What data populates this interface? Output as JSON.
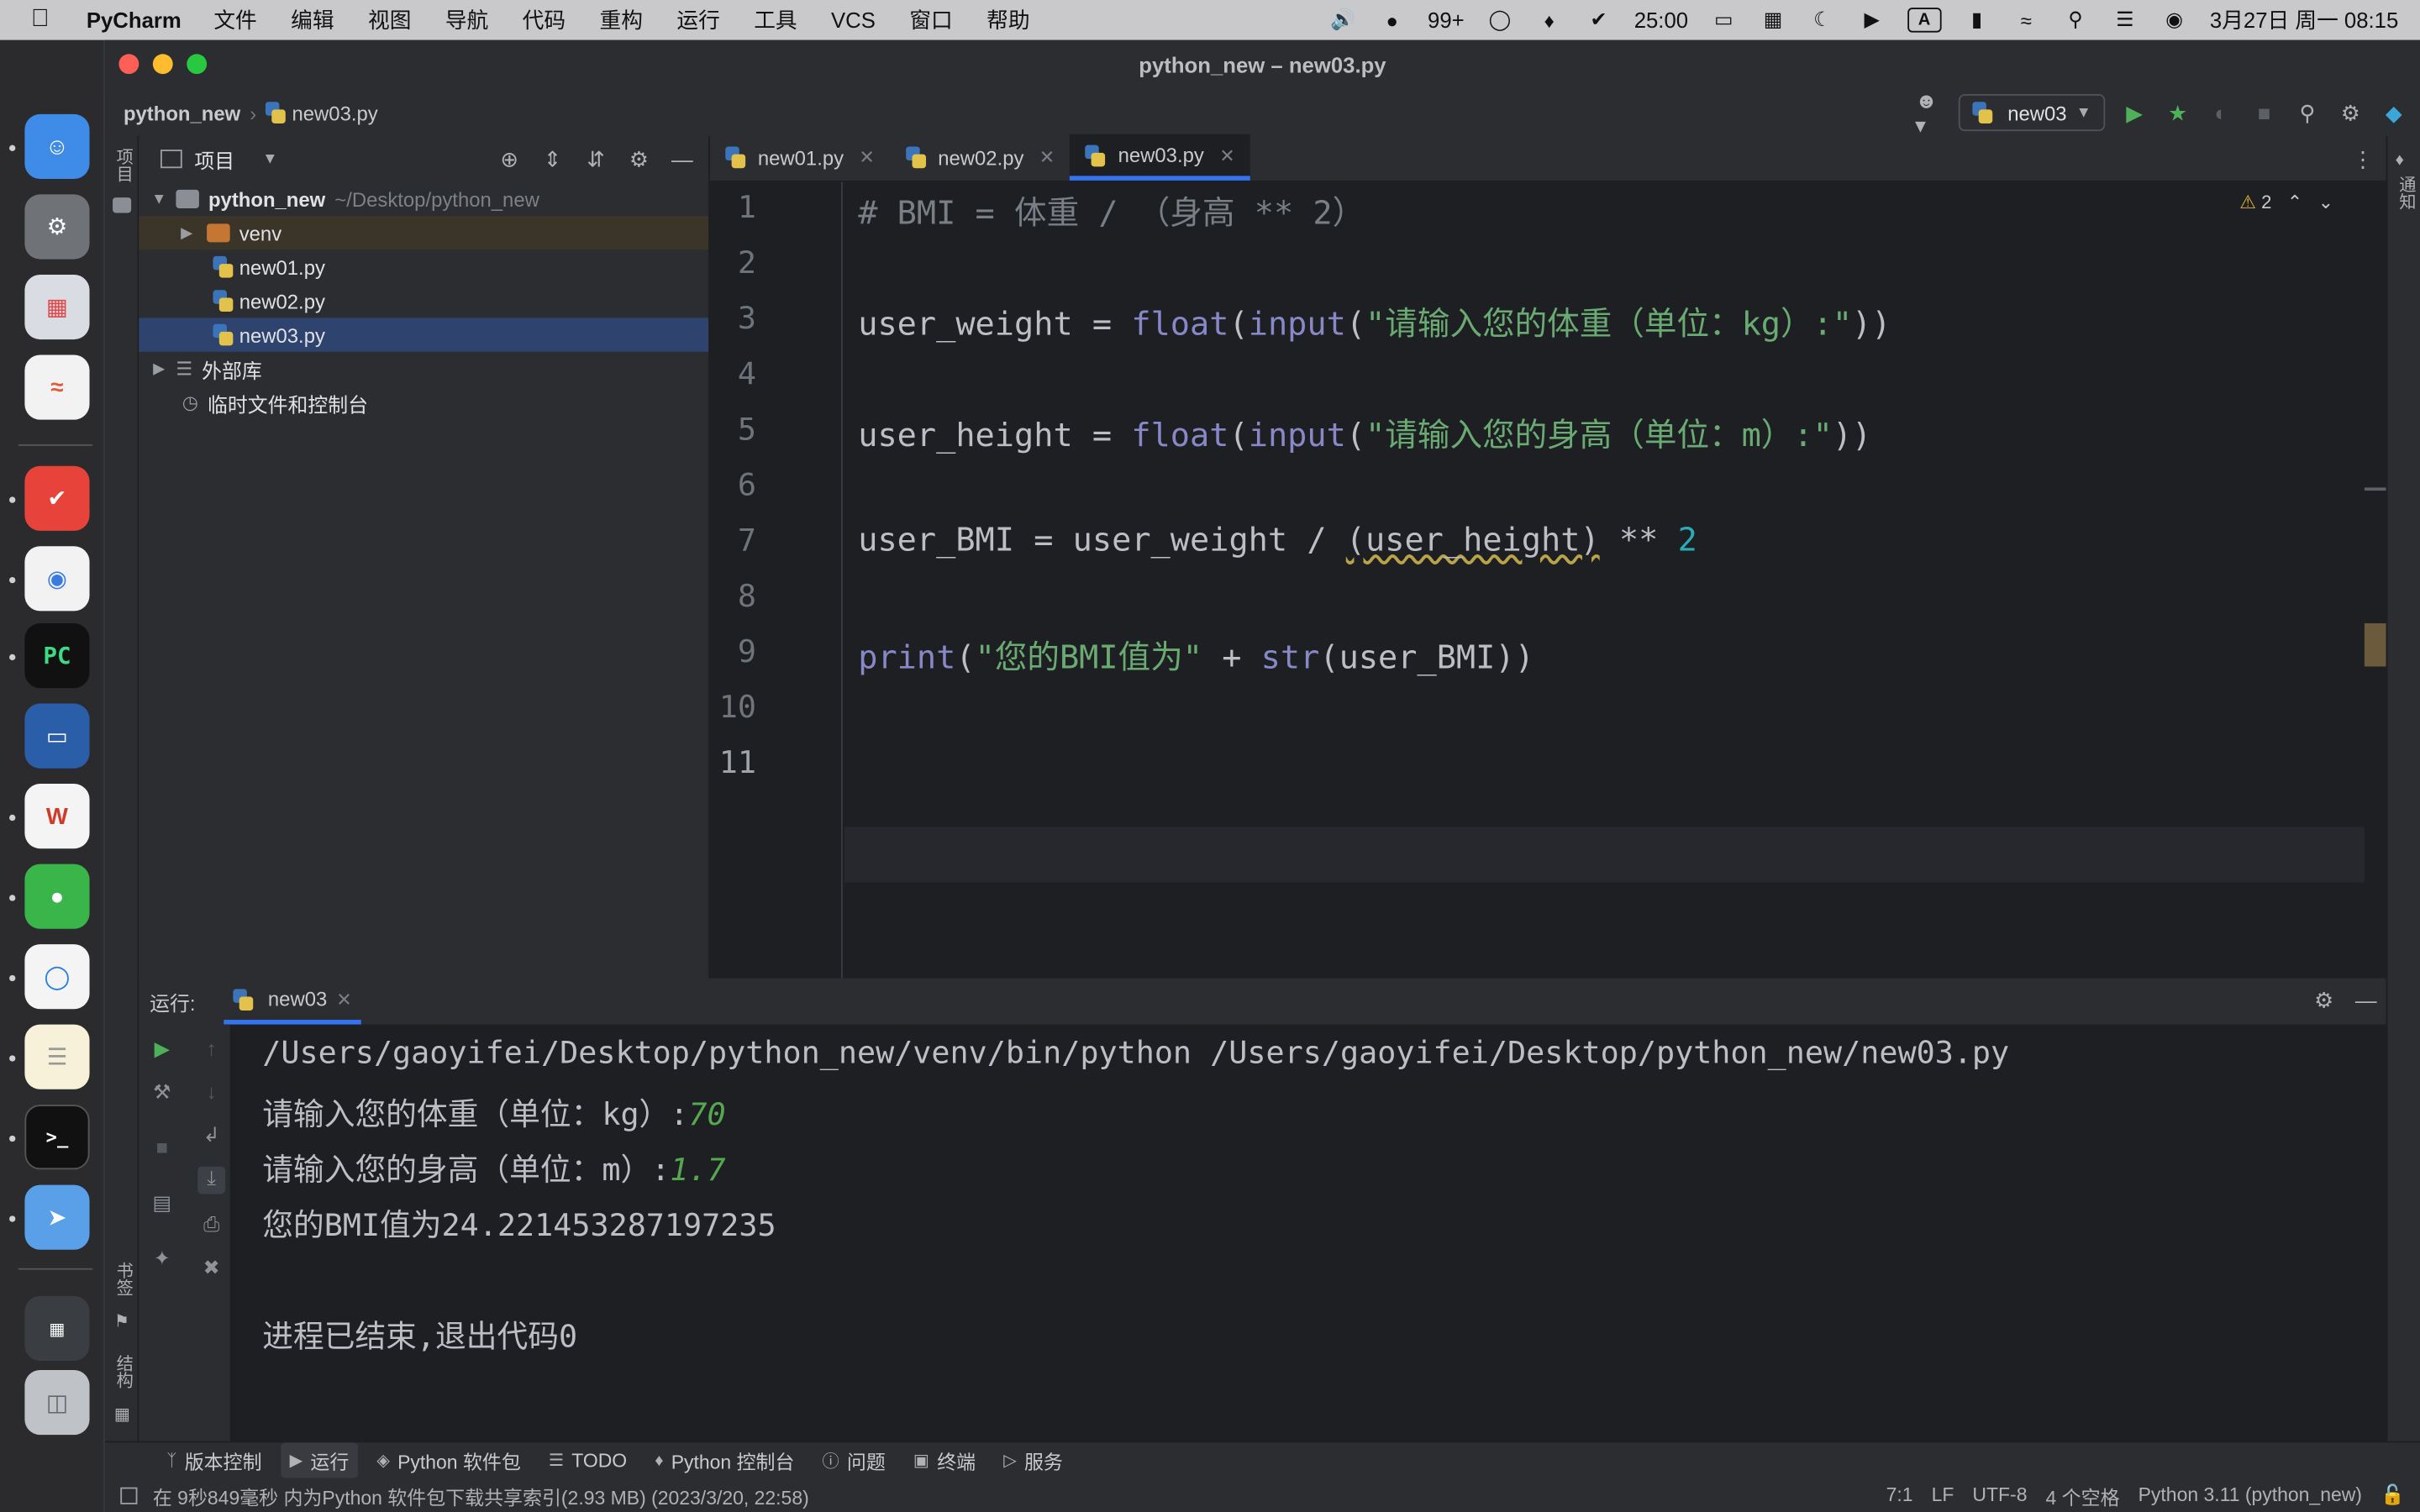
{
  "menubar": {
    "app_name": "PyCharm",
    "items": [
      "文件",
      "编辑",
      "视图",
      "导航",
      "代码",
      "重构",
      "运行",
      "工具",
      "VCS",
      "窗口",
      "帮助"
    ],
    "wechat_badge": "99+",
    "timer": "25:00",
    "input_method": "A",
    "clock": "3月27日 周一  08:15"
  },
  "window": {
    "title": "python_new – new03.py",
    "breadcrumb": {
      "project": "python_new",
      "file": "new03.py"
    },
    "run_config": "new03"
  },
  "sidebar_labels": {
    "project": "项目",
    "bookmarks": "书签",
    "structure": "结构",
    "notifications": "通知"
  },
  "project_panel": {
    "header": "项目",
    "root": {
      "name": "python_new",
      "path": "~/Desktop/python_new"
    },
    "items": [
      {
        "name": "venv",
        "type": "folder"
      },
      {
        "name": "new01.py",
        "type": "file"
      },
      {
        "name": "new02.py",
        "type": "file"
      },
      {
        "name": "new03.py",
        "type": "file",
        "selected": true
      }
    ],
    "external_libs": "外部库",
    "scratches": "临时文件和控制台"
  },
  "editor": {
    "tabs": [
      "new01.py",
      "new02.py",
      "new03.py"
    ],
    "active_tab": "new03.py",
    "warning_count": "2",
    "line_numbers": [
      "1",
      "2",
      "3",
      "4",
      "5",
      "6",
      "7",
      "8",
      "9",
      "10",
      "11"
    ],
    "lines": {
      "l1": "# BMI = 体重 / （身高 ** 2）",
      "l3_var": "user_weight",
      "l3_op": " = ",
      "l3_fn1": "float",
      "l3_fn2": "input",
      "l3_str": "\"请输入您的体重（单位：kg）:\"",
      "l5_var": "user_height",
      "l5_op": " = ",
      "l5_fn1": "float",
      "l5_fn2": "input",
      "l5_str": "\"请输入您的身高（单位：m）:\"",
      "l7_a": "user_BMI = user_weight / ",
      "l7_warn": "(user_height)",
      "l7_b": " ** ",
      "l7_num": "2",
      "l9_fn1": "print",
      "l9_str": "\"您的BMI值为\"",
      "l9_mid": " + ",
      "l9_fn2": "str",
      "l9_arg": "user_BMI"
    }
  },
  "run_panel": {
    "label": "运行:",
    "tab": "new03",
    "output": {
      "cmd": "/Users/gaoyifei/Desktop/python_new/venv/bin/python /Users/gaoyifei/Desktop/python_new/new03.py",
      "prompt1": "请输入您的体重（单位：kg）:",
      "input1": "70",
      "prompt2": "请输入您的身高（单位：m）:",
      "input2": "1.7",
      "result": "您的BMI值为24.221453287197235",
      "exit": "进程已结束,退出代码0"
    }
  },
  "bottom_toolbar": [
    "版本控制",
    "运行",
    "Python 软件包",
    "TODO",
    "Python 控制台",
    "问题",
    "终端",
    "服务"
  ],
  "statusbar": {
    "message": "在 9秒849毫秒 内为Python 软件包下载共享索引(2.93 MB) (2023/3/20, 22:58)",
    "position": "7:1",
    "line_sep": "LF",
    "encoding": "UTF-8",
    "indent": "4 个空格",
    "interpreter": "Python 3.11 (python_new)"
  }
}
